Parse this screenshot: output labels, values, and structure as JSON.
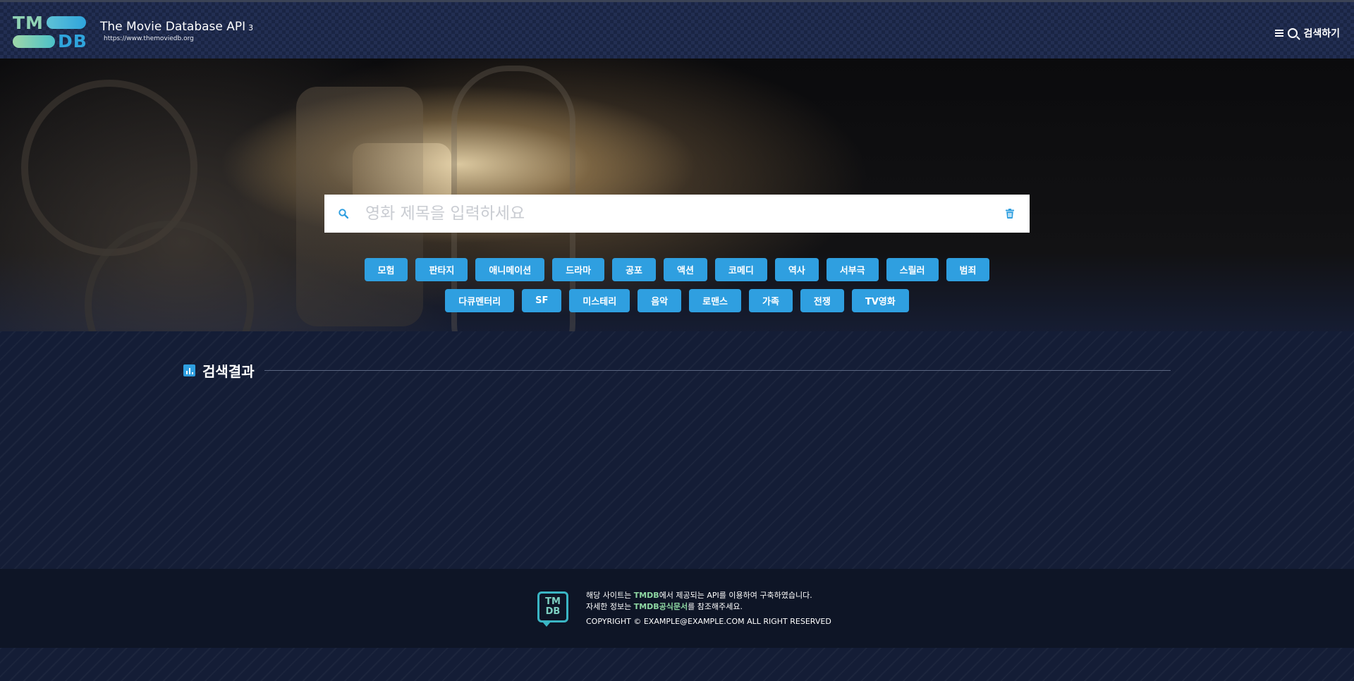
{
  "header": {
    "logo": {
      "top": "TM",
      "bottom": "DB"
    },
    "title": "The Movie Database API",
    "version": "3",
    "url": "https://www.themoviedb.org",
    "search_label": "검색하기",
    "menu_icon": "menu-icon",
    "search_icon": "search-icon"
  },
  "search": {
    "placeholder": "영화 제목을 입력하세요",
    "value": "",
    "search_icon": "search-icon",
    "clear_icon": "trash-icon",
    "accent_color": "#2f9fe0"
  },
  "genres": {
    "row1": [
      "모험",
      "판타지",
      "애니메이션",
      "드라마",
      "공포",
      "액션",
      "코메디",
      "역사",
      "서부극",
      "스릴러",
      "범죄"
    ],
    "row2": [
      "다큐멘터리",
      "SF",
      "미스테리",
      "음악",
      "로맨스",
      "가족",
      "전쟁",
      "TV영화"
    ]
  },
  "results": {
    "title": "검색결과",
    "icon": "bar-chart-icon"
  },
  "footer": {
    "logo": {
      "top": "TM",
      "bottom": "DB"
    },
    "line1_pre": "해당 사이트는 ",
    "line1_hl": "TMDB",
    "line1_post": "에서 제공되는 API를 이용하여 구축하였습니다.",
    "line2_pre": "자세한 정보는 ",
    "line2_hl": "TMDB공식문서",
    "line2_post": "를 참조해주세요.",
    "copyright": "COPYRIGHT © EXAMPLE@EXAMPLE.COM ALL RIGHT RESERVED",
    "highlight_color": "#8fd8a3"
  },
  "colors": {
    "background": "#131c33",
    "header_bg": "#1a2544",
    "button": "#2f9fe0",
    "footer_bg": "#0e1526"
  }
}
